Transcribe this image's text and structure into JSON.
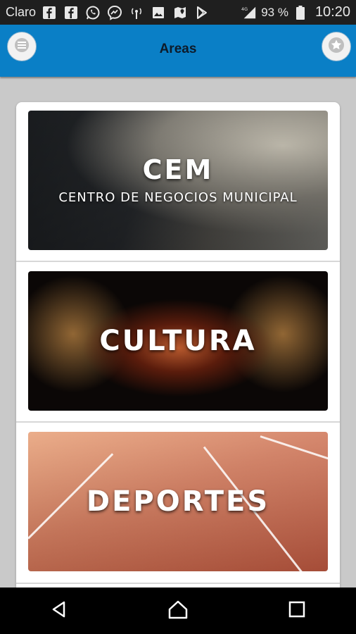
{
  "status_bar": {
    "carrier": "Claro",
    "notification_icons": [
      "facebook-icon",
      "facebook-icon",
      "whatsapp-icon",
      "messenger-icon",
      "antenna-icon",
      "image-icon",
      "maps-icon",
      "play-store-icon"
    ],
    "network": "4G",
    "battery": "93 %",
    "time": "10:20"
  },
  "app_bar": {
    "title": "Areas",
    "left_icon": "menu-icon",
    "right_icon": "star-icon",
    "color": "#0a7fc6"
  },
  "areas": [
    {
      "title": "CEM",
      "subtitle": "CENTRO DE NEGOCIOS MUNICIPAL"
    },
    {
      "title": "CULTURA",
      "subtitle": ""
    },
    {
      "title": "DEPORTES",
      "subtitle": ""
    }
  ],
  "nav_bar": {
    "buttons": [
      "back-icon",
      "home-icon",
      "recents-icon"
    ]
  }
}
